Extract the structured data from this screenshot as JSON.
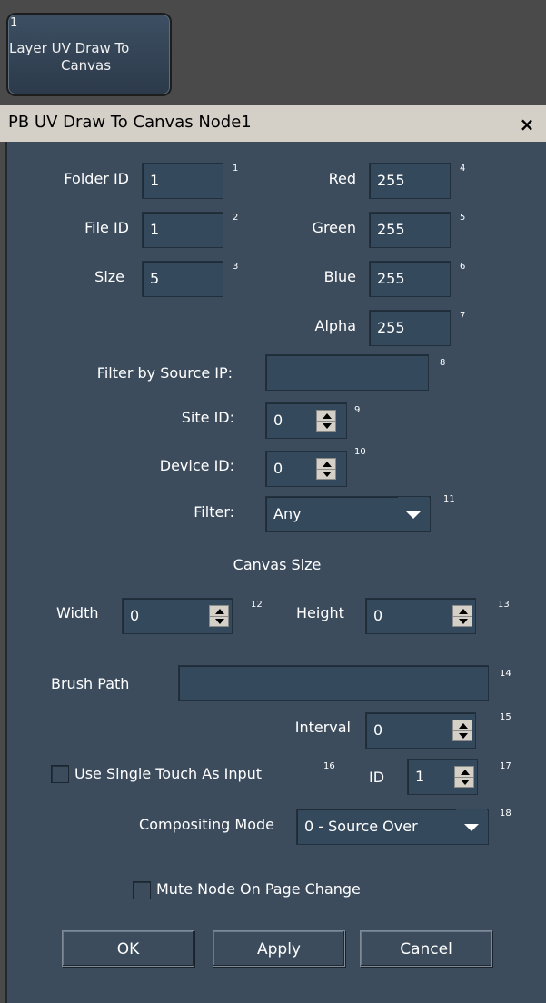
{
  "node": {
    "number": "1",
    "title_line1": "Layer UV Draw To",
    "title_line2": "Canvas"
  },
  "dialog": {
    "title": "PB UV Draw To Canvas Node1",
    "close_glyph": "×"
  },
  "fields": {
    "folder_id": {
      "label": "Folder ID",
      "value": "1",
      "index": "1"
    },
    "file_id": {
      "label": "File ID",
      "value": "1",
      "index": "2"
    },
    "size": {
      "label": "Size",
      "value": "5",
      "index": "3"
    },
    "red": {
      "label": "Red",
      "value": "255",
      "index": "4"
    },
    "green": {
      "label": "Green",
      "value": "255",
      "index": "5"
    },
    "blue": {
      "label": "Blue",
      "value": "255",
      "index": "6"
    },
    "alpha": {
      "label": "Alpha",
      "value": "255",
      "index": "7"
    },
    "filter_ip": {
      "label": "Filter by Source IP:",
      "value": "",
      "index": "8"
    },
    "site_id": {
      "label": "Site ID:",
      "value": "0",
      "index": "9"
    },
    "device_id": {
      "label": "Device ID:",
      "value": "0",
      "index": "10"
    },
    "filter": {
      "label": "Filter:",
      "value": "Any",
      "index": "11"
    },
    "canvas_heading": "Canvas Size",
    "width": {
      "label": "Width",
      "value": "0",
      "index": "12"
    },
    "height": {
      "label": "Height",
      "value": "0",
      "index": "13"
    },
    "brush_path": {
      "label": "Brush Path",
      "value": "",
      "index": "14"
    },
    "interval": {
      "label": "Interval",
      "value": "0",
      "index": "15"
    },
    "single_touch": {
      "label": "Use Single Touch As Input",
      "index": "16",
      "checked": false
    },
    "touch_id": {
      "label": "ID",
      "value": "1",
      "index": "17"
    },
    "compositing": {
      "label": "Compositing Mode",
      "value": "0 - Source Over",
      "index": "18"
    },
    "mute_node": {
      "label": "Mute Node On Page Change",
      "checked": false
    }
  },
  "buttons": {
    "ok": "OK",
    "apply": "Apply",
    "cancel": "Cancel"
  },
  "colors": {
    "panel_bg": "#3c4c5d",
    "field_bg": "#34495c",
    "titlebar_bg": "#d4d0c8",
    "outer_bg": "#4a4a4a"
  }
}
